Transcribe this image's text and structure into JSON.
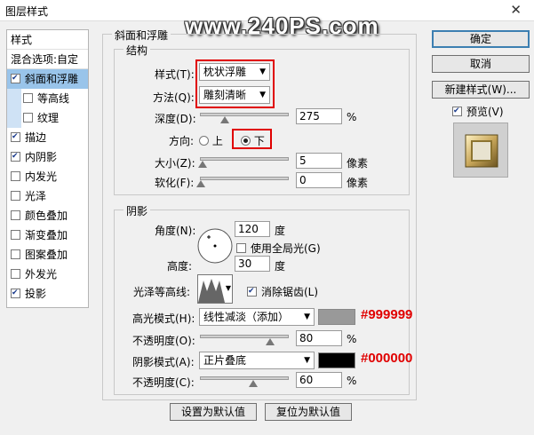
{
  "window": {
    "title": "图层样式",
    "close_glyph": "✕"
  },
  "watermark": "www.240PS.com",
  "style_list": [
    {
      "label": "样式",
      "kind": "header"
    },
    {
      "label": "混合选项:自定",
      "kind": "header"
    },
    {
      "label": "斜面和浮雕",
      "checked": true,
      "selected": true
    },
    {
      "label": "等高线",
      "checked": false,
      "sub": true
    },
    {
      "label": "纹理",
      "checked": false,
      "sub": true
    },
    {
      "label": "描边",
      "checked": true
    },
    {
      "label": "内阴影",
      "checked": true
    },
    {
      "label": "内发光",
      "checked": false
    },
    {
      "label": "光泽",
      "checked": false
    },
    {
      "label": "颜色叠加",
      "checked": false
    },
    {
      "label": "渐变叠加",
      "checked": false
    },
    {
      "label": "图案叠加",
      "checked": false
    },
    {
      "label": "外发光",
      "checked": false
    },
    {
      "label": "投影",
      "checked": true
    }
  ],
  "bevel": {
    "group_title": "斜面和浮雕",
    "structure_title": "结构",
    "style_label": "样式(T):",
    "style_value": "枕状浮雕",
    "technique_label": "方法(Q):",
    "technique_value": "雕刻清晰",
    "depth_label": "深度(D):",
    "depth_value": "275",
    "depth_unit": "%",
    "depth_fraction": 0.275,
    "direction_label": "方向:",
    "direction_up": "上",
    "direction_down": "下",
    "direction_selected": "下",
    "size_label": "大小(Z):",
    "size_value": "5",
    "size_unit": "像素",
    "size_fraction": 0.02,
    "soften_label": "软化(F):",
    "soften_value": "0",
    "soften_unit": "像素",
    "soften_fraction": 0.0
  },
  "shading": {
    "group_title": "阴影",
    "angle_label": "角度(N):",
    "angle_value": "120",
    "angle_unit": "度",
    "global_light_label": "使用全局光(G)",
    "global_light_checked": false,
    "altitude_label": "高度:",
    "altitude_value": "30",
    "altitude_unit": "度",
    "gloss_contour_label": "光泽等高线:",
    "antialias_label": "消除锯齿(L)",
    "antialias_checked": true,
    "highlight_mode_label": "高光模式(H):",
    "highlight_mode_value": "线性减淡（添加）",
    "highlight_color": "#999999",
    "highlight_opacity_label": "不透明度(O):",
    "highlight_opacity_value": "80",
    "highlight_opacity_fraction": 0.8,
    "shadow_mode_label": "阴影模式(A):",
    "shadow_mode_value": "正片叠底",
    "shadow_color": "#000000",
    "shadow_opacity_label": "不透明度(C):",
    "shadow_opacity_value": "60",
    "shadow_opacity_fraction": 0.6,
    "percent_unit": "%"
  },
  "annotations": {
    "highlight_hex": "#999999",
    "shadow_hex": "#000000"
  },
  "buttons": {
    "make_default": "设置为默认值",
    "reset_default": "复位为默认值",
    "ok": "确定",
    "cancel": "取消",
    "new_style": "新建样式(W)...",
    "preview_label": "预览(V)",
    "preview_checked": true
  },
  "colors": {
    "selection": "#99c4ea",
    "annotation_red": "#e00000",
    "gold": "#c9a75a"
  }
}
